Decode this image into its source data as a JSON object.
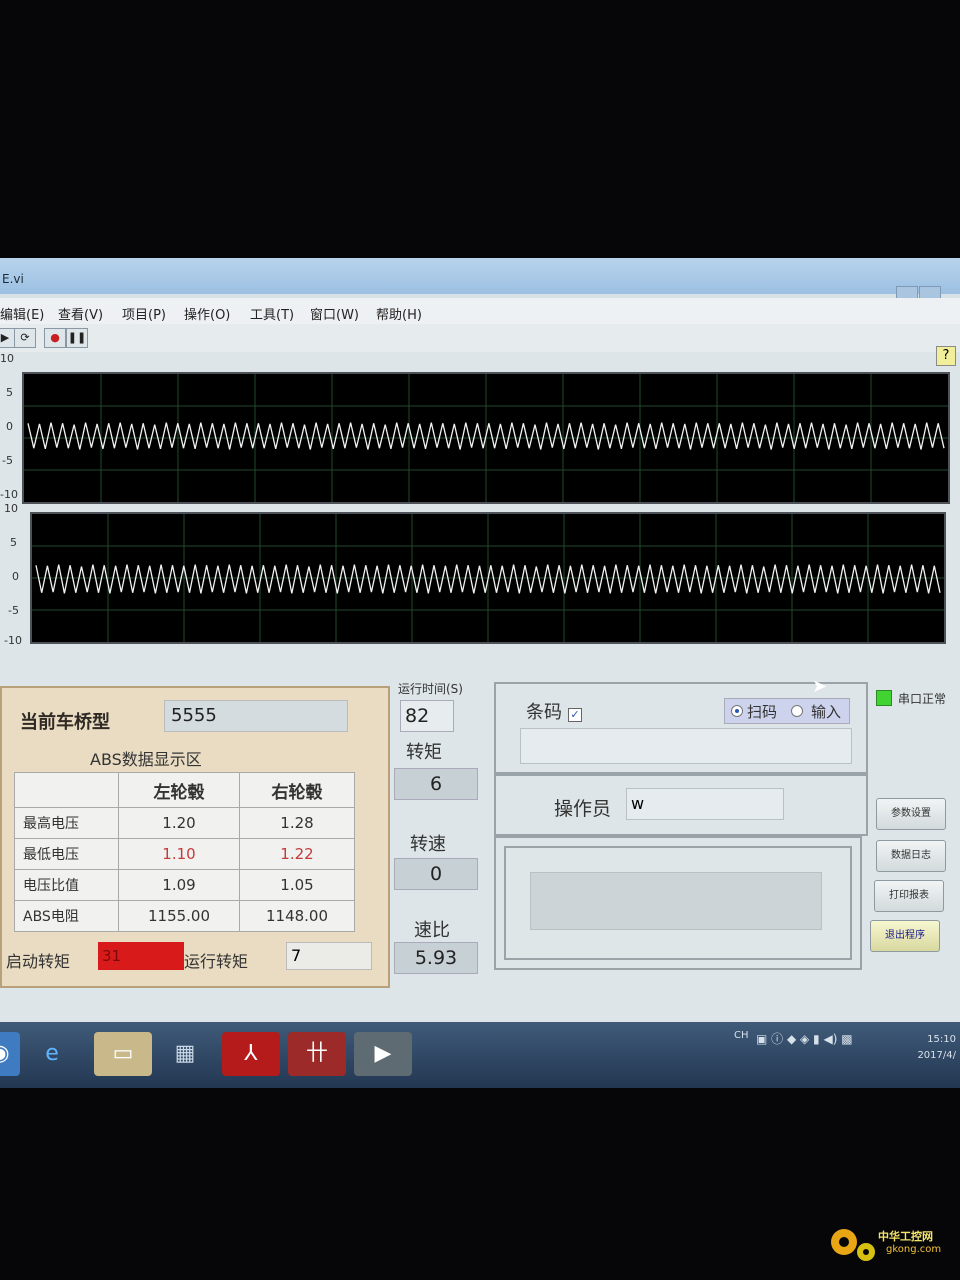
{
  "window": {
    "title": "E.vi"
  },
  "menu": [
    "编辑(E)",
    "查看(V)",
    "项目(P)",
    "操作(O)",
    "工具(T)",
    "窗口(W)",
    "帮助(H)"
  ],
  "toolbar": {
    "help_label": "?"
  },
  "graph1": {
    "yticks": [
      "10",
      "5",
      "0",
      "-5",
      "-10"
    ]
  },
  "graph2": {
    "yticks": [
      "10",
      "5",
      "0",
      "-5",
      "-10"
    ]
  },
  "chart_data": [
    {
      "type": "line",
      "ylim": [
        -10,
        10
      ],
      "grid": true,
      "series": [
        {
          "values": [
            2.3,
            -1.6,
            2.2,
            -1.7,
            2.4,
            -1.5,
            2.3,
            -1.6,
            2.1,
            -1.8,
            2.4,
            -1.5,
            2.2,
            -1.7,
            2.3,
            -1.6,
            2.4,
            -1.5,
            2.2,
            -1.8,
            2.3,
            -1.6,
            2.1,
            -1.7,
            2.4,
            -1.5,
            2.3,
            -1.6,
            2.2,
            -1.7,
            2.4,
            -1.5,
            2.3,
            -1.6,
            2.2,
            -1.8,
            2.4,
            -1.5,
            2.3,
            -1.6
          ]
        }
      ]
    },
    {
      "type": "line",
      "ylim": [
        -10,
        10
      ],
      "grid": true,
      "series": [
        {
          "values": [
            2.0,
            -2.3,
            1.9,
            -2.2,
            2.1,
            -2.4,
            2.0,
            -2.3,
            1.8,
            -2.2,
            2.1,
            -2.3,
            2.0,
            -2.4,
            1.9,
            -2.2,
            2.1,
            -2.3,
            2.0,
            -2.2,
            1.9,
            -2.4,
            2.1,
            -2.3,
            2.0,
            -2.2,
            1.9,
            -2.3,
            2.1,
            -2.4,
            2.0,
            -2.2,
            1.9,
            -2.3,
            2.1,
            -2.2,
            2.0,
            -2.4,
            1.9,
            -2.3
          ]
        }
      ]
    }
  ],
  "abs": {
    "model_label": "当前车桥型",
    "model_value": "5555",
    "subtitle": "ABS数据显示区",
    "col_left": "左轮毂",
    "col_right": "右轮毂",
    "rows": [
      {
        "label": "最高电压",
        "left": "1.20",
        "right": "1.28"
      },
      {
        "label": "最低电压",
        "left": "1.10",
        "right": "1.22"
      },
      {
        "label": "电压比值",
        "left": "1.09",
        "right": "1.05"
      },
      {
        "label": "ABS电阻",
        "left": "1155.00",
        "right": "1148.00"
      }
    ],
    "start_torque_label": "启动转矩",
    "start_torque_value": "31",
    "run_torque_label": "运行转矩",
    "run_torque_value": "7"
  },
  "metrics": {
    "run_time_label": "运行时间(S)",
    "run_time_value": "82",
    "torque_label": "转矩",
    "torque_value": "6",
    "speed_label": "转速",
    "speed_value": "0",
    "ratio_label": "速比",
    "ratio_value": "5.93"
  },
  "barcode": {
    "label": "条码",
    "radio_scan": "扫码",
    "radio_input": "输入",
    "value": ""
  },
  "operator": {
    "label": "操作员",
    "value": "w"
  },
  "status": {
    "text": "串口正常",
    "color": "#41d331"
  },
  "buttons": {
    "params": "参数设置",
    "log": "数据日志",
    "print": "打印报表",
    "exit": "退出程序"
  },
  "taskbar": {
    "lang": "CH",
    "time": "15:10",
    "date": "2017/4/"
  },
  "watermark": {
    "text": "中华工控网",
    "url": "gkong.com"
  }
}
